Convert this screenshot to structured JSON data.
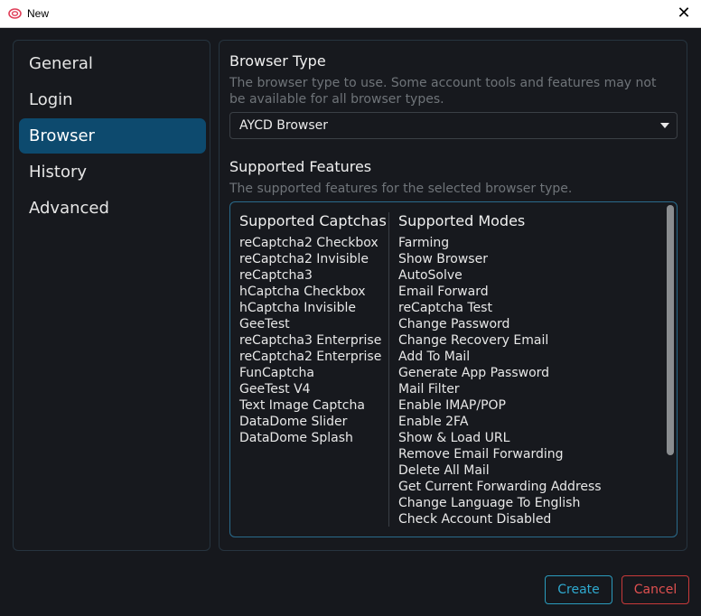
{
  "window": {
    "title": "New",
    "app_icon": "app-logo-icon",
    "close_glyph": "✕"
  },
  "sidebar": {
    "items": [
      {
        "label": "General",
        "active": false
      },
      {
        "label": "Login",
        "active": false
      },
      {
        "label": "Browser",
        "active": true
      },
      {
        "label": "History",
        "active": false
      },
      {
        "label": "Advanced",
        "active": false
      }
    ]
  },
  "browser_type": {
    "heading": "Browser Type",
    "description": "The browser type to use. Some account tools and features may not be available for all browser types.",
    "selected": "AYCD Browser"
  },
  "supported_features": {
    "heading": "Supported Features",
    "description": "The supported features for the selected browser type.",
    "captchas_title": "Supported Captchas",
    "captchas": [
      "reCaptcha2 Checkbox",
      "reCaptcha2 Invisible",
      "reCaptcha3",
      "hCaptcha Checkbox",
      "hCaptcha Invisible",
      "GeeTest",
      "reCaptcha3 Enterprise",
      "reCaptcha2 Enterprise",
      "FunCaptcha",
      "GeeTest V4",
      "Text Image Captcha",
      "DataDome Slider",
      "DataDome Splash"
    ],
    "modes_title": "Supported Modes",
    "modes": [
      "Farming",
      "Show Browser",
      "AutoSolve",
      "Email Forward",
      "reCaptcha Test",
      "Change Password",
      "Change Recovery Email",
      "Add To Mail",
      "Generate App Password",
      "Mail Filter",
      "Enable IMAP/POP",
      "Enable 2FA",
      "Show & Load URL",
      "Remove Email Forwarding",
      "Delete All Mail",
      "Get Current Forwarding Address",
      "Change Language To English",
      "Check Account Disabled"
    ]
  },
  "footer": {
    "create_label": "Create",
    "cancel_label": "Cancel"
  },
  "colors": {
    "accent": "#0d4a6e",
    "create": "#2fa9cf",
    "cancel": "#e05050",
    "background": "#16181d"
  }
}
